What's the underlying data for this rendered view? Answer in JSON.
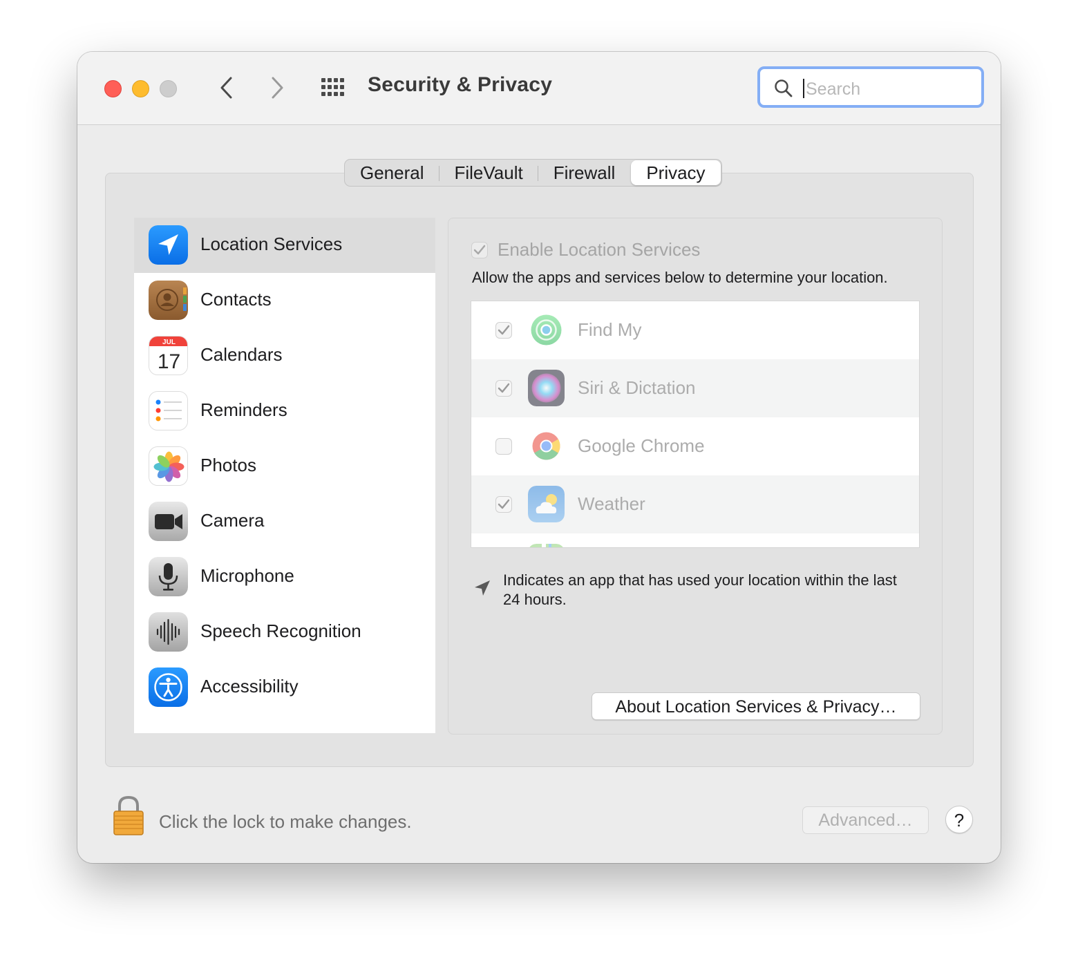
{
  "window": {
    "title": "Security & Privacy"
  },
  "search": {
    "placeholder": "Search",
    "value": ""
  },
  "tabs": [
    {
      "label": "General"
    },
    {
      "label": "FileVault"
    },
    {
      "label": "Firewall"
    },
    {
      "label": "Privacy",
      "active": true
    }
  ],
  "sidebar": {
    "items": [
      {
        "label": "Location Services",
        "icon": "location-arrow-icon",
        "selected": true
      },
      {
        "label": "Contacts",
        "icon": "contacts-icon"
      },
      {
        "label": "Calendars",
        "icon": "calendar-icon",
        "month": "JUL",
        "day": "17"
      },
      {
        "label": "Reminders",
        "icon": "reminders-icon"
      },
      {
        "label": "Photos",
        "icon": "photos-icon"
      },
      {
        "label": "Camera",
        "icon": "camera-icon"
      },
      {
        "label": "Microphone",
        "icon": "microphone-icon"
      },
      {
        "label": "Speech Recognition",
        "icon": "speech-waveform-icon"
      },
      {
        "label": "Accessibility",
        "icon": "accessibility-icon"
      }
    ]
  },
  "location": {
    "enable_label": "Enable Location Services",
    "enable_checked": true,
    "description": "Allow the apps and services below to determine your location.",
    "apps": [
      {
        "label": "Find My",
        "checked": true,
        "icon": "find-my-icon"
      },
      {
        "label": "Siri & Dictation",
        "checked": true,
        "icon": "siri-icon"
      },
      {
        "label": "Google Chrome",
        "checked": false,
        "icon": "chrome-icon"
      },
      {
        "label": "Weather",
        "checked": true,
        "icon": "weather-icon"
      }
    ],
    "note": "Indicates an app that has used your location within the last 24 hours.",
    "about_button": "About Location Services & Privacy…"
  },
  "footer": {
    "lock_text": "Click the lock to make changes.",
    "advanced_button": "Advanced…",
    "help_button": "?"
  },
  "colors": {
    "accent": "#1a82fb",
    "close": "#ff5f57",
    "minimize": "#febc2e",
    "search_focus": "#84aef5"
  }
}
